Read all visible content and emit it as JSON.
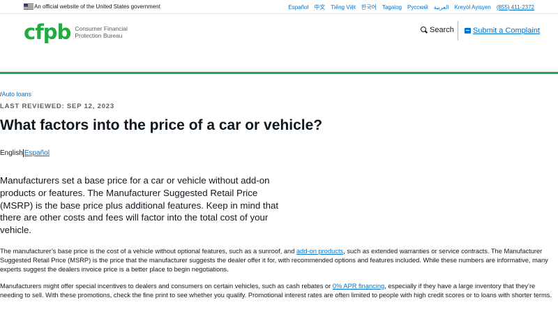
{
  "banner": {
    "gov_text": "An official website of the United States government",
    "languages": [
      "Español",
      "中文",
      "Tiếng Việt",
      "한국어",
      "Tagalog",
      "Русский",
      "العربية",
      "Kreyòl Ayisyen"
    ],
    "phone": "(855) 411-2372"
  },
  "header": {
    "logo_mark": "cfpb",
    "logo_text_line1": "Consumer Financial",
    "logo_text_line2": "Protection Bureau",
    "search_label": "Search",
    "complaint_label": "Submit a Complaint",
    "brand_green": "#20aa3f"
  },
  "article": {
    "breadcrumb_prefix": "/",
    "breadcrumb_link": "Auto loans",
    "last_reviewed": "LAST REVIEWED: SEP 12, 2023",
    "title": "What factors into the price of a car or vehicle?",
    "lang_current": "English",
    "lang_alt": "Español",
    "lead": "Manufacturers set a base price for a car or vehicle without add-on products or features. The Manufacturer Suggested Retail Price (MSRP) is the base price plus additional features. Keep in mind that there are other costs and fees will factor into the total cost of your vehicle.",
    "p1_before": "The manufacturer’s base price is the cost of a vehicle without optional features, such as a sunroof, and ",
    "p1_link": "add-on products",
    "p1_after": ", such as extended warranties or service contracts. The Manufacturer Suggested Retail Price (MSRP) is the price that the manufacturer suggests the dealer offer it for, with recommended options and features included. While these numbers are informative, many experts suggest the dealers invoice price is a better place to begin negotiations.",
    "p2_before": "Manufacturers might offer special incentives to dealers and consumers on certain vehicles, such as cash rebates or ",
    "p2_link": "0% APR financing",
    "p2_after": ", especially if they have a large inventory that they’re needing to sell. With these promotions, check the fine print to see whether you qualify. Promotional interest rates are often limited to people with high credit scores or to loans with shorter terms."
  }
}
